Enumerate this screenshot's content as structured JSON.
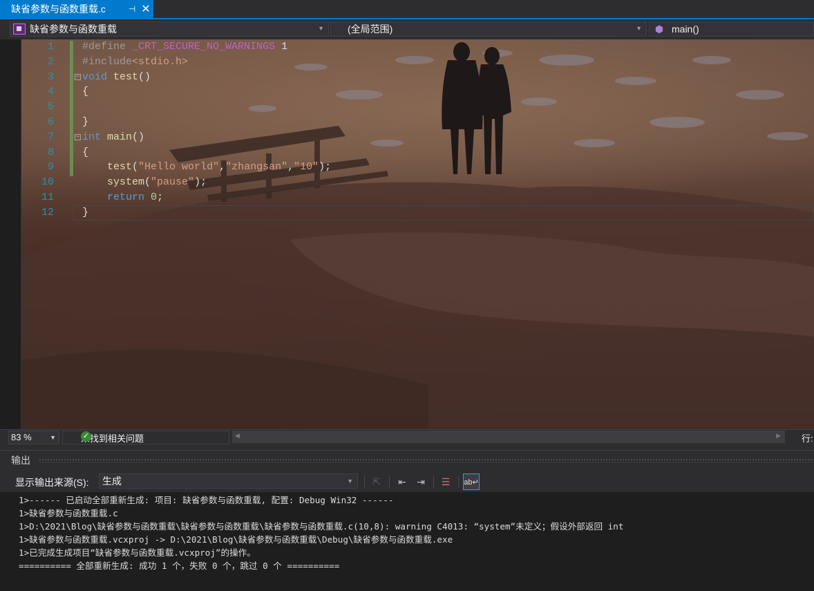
{
  "tab": {
    "title": "缺省参数与函数重载.c",
    "pin": "⊣",
    "close": "✕"
  },
  "nav": {
    "project": "缺省参数与函数重载",
    "scope": "(全局范围)",
    "member": "main()"
  },
  "editor": {
    "line_numbers": [
      "1",
      "2",
      "3",
      "4",
      "5",
      "6",
      "7",
      "8",
      "9",
      "10",
      "11",
      "12"
    ],
    "lines": [
      [
        {
          "t": "#define ",
          "c": "pp"
        },
        {
          "t": "_CRT_SECURE_NO_WARNINGS",
          "c": "mac"
        },
        {
          "t": " 1",
          "c": "pl"
        }
      ],
      [
        {
          "t": "#include",
          "c": "pp"
        },
        {
          "t": "<stdio.h>",
          "c": "inc"
        }
      ],
      [
        {
          "t": "void",
          "c": "kw"
        },
        {
          "t": " ",
          "c": "pl"
        },
        {
          "t": "test",
          "c": "fn"
        },
        {
          "t": "()",
          "c": "pl"
        }
      ],
      [
        {
          "t": "{",
          "c": "pl"
        }
      ],
      [],
      [
        {
          "t": "}",
          "c": "pl"
        }
      ],
      [
        {
          "t": "int",
          "c": "kw"
        },
        {
          "t": " ",
          "c": "pl"
        },
        {
          "t": "main",
          "c": "fn"
        },
        {
          "t": "()",
          "c": "pl"
        }
      ],
      [
        {
          "t": "{",
          "c": "pl"
        }
      ],
      [
        {
          "t": "    ",
          "c": "pl"
        },
        {
          "t": "test",
          "c": "fn"
        },
        {
          "t": "(",
          "c": "pl"
        },
        {
          "t": "\"Hello world\"",
          "c": "str"
        },
        {
          "t": ",",
          "c": "pl"
        },
        {
          "t": "\"zhangsan\"",
          "c": "str"
        },
        {
          "t": ",",
          "c": "pl"
        },
        {
          "t": "\"10\"",
          "c": "str"
        },
        {
          "t": ");",
          "c": "pl"
        }
      ],
      [
        {
          "t": "    ",
          "c": "pl"
        },
        {
          "t": "system",
          "c": "fn"
        },
        {
          "t": "(",
          "c": "pl"
        },
        {
          "t": "\"pause\"",
          "c": "str"
        },
        {
          "t": ");",
          "c": "pl"
        }
      ],
      [
        {
          "t": "    ",
          "c": "pl"
        },
        {
          "t": "return",
          "c": "kw"
        },
        {
          "t": " ",
          "c": "pl"
        },
        {
          "t": "0",
          "c": "num"
        },
        {
          "t": ";",
          "c": "pl"
        }
      ],
      [
        {
          "t": "}",
          "c": "pl"
        }
      ]
    ]
  },
  "status": {
    "zoom": "83 %",
    "issues": "未找到相关问题",
    "linecol": "行:"
  },
  "output": {
    "title": "输出",
    "source_label": "显示输出来源(S):",
    "source_value": "生成",
    "lines": [
      "1>------ 已启动全部重新生成: 项目: 缺省参数与函数重载, 配置: Debug Win32 ------",
      "1>缺省参数与函数重载.c",
      "1>D:\\2021\\Blog\\缺省参数与函数重载\\缺省参数与函数重载\\缺省参数与函数重载.c(10,8): warning C4013: “system”未定义；假设外部返回 int",
      "1>缺省参数与函数重载.vcxproj -> D:\\2021\\Blog\\缺省参数与函数重载\\Debug\\缺省参数与函数重载.exe",
      "1>已完成生成项目“缺省参数与函数重载.vcxproj”的操作。",
      "========== 全部重新生成: 成功 1 个，失败 0 个，跳过 0 个 =========="
    ]
  },
  "colors": {
    "accent": "#007acc",
    "line_number": "#2b91af",
    "keyword": "#569cd6",
    "string": "#d69d85",
    "macro": "#bd63c5",
    "ok": "#388a34"
  }
}
